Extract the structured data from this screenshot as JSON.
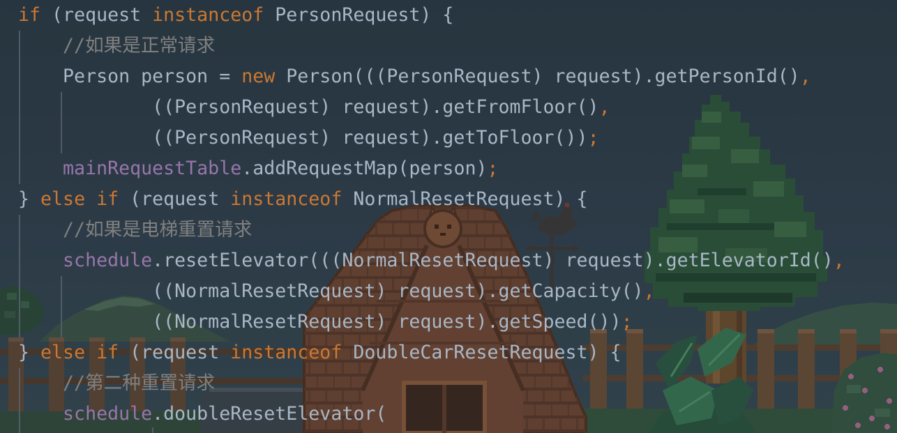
{
  "editor": {
    "colors": {
      "background": "#2b3a45",
      "text": "#A9B7C6",
      "keyword": "#CC7832",
      "field": "#9876AA",
      "comment": "#808080",
      "punctuation": "#CC7832",
      "indent_guide": "#56626d"
    },
    "lines": [
      [
        {
          "kw": "if"
        },
        {
          "txt": " (request "
        },
        {
          "kw": "instanceof"
        },
        {
          "txt": " PersonRequest) {"
        }
      ],
      [
        {
          "txt": "    "
        },
        {
          "cmt": "//如果是正常请求"
        }
      ],
      [
        {
          "txt": "    Person person = "
        },
        {
          "kw": "new"
        },
        {
          "txt": " Person(((PersonRequest) request).getPersonId()"
        },
        {
          "pun": ","
        }
      ],
      [
        {
          "txt": "            ((PersonRequest) request).getFromFloor()"
        },
        {
          "pun": ","
        }
      ],
      [
        {
          "txt": "            ((PersonRequest) request).getToFloor())"
        },
        {
          "pun": ";"
        }
      ],
      [
        {
          "txt": "    "
        },
        {
          "fld": "mainRequestTable"
        },
        {
          "txt": ".addRequestMap(person)"
        },
        {
          "pun": ";"
        }
      ],
      [
        {
          "txt": "} "
        },
        {
          "kw": "else if"
        },
        {
          "txt": " (request "
        },
        {
          "kw": "instanceof"
        },
        {
          "txt": " NormalResetRequest) {"
        }
      ],
      [
        {
          "txt": "    "
        },
        {
          "cmt": "//如果是电梯重置请求"
        }
      ],
      [
        {
          "txt": "    "
        },
        {
          "fld": "schedule"
        },
        {
          "txt": ".resetElevator(((NormalResetRequest) request).getElevatorId()"
        },
        {
          "pun": ","
        }
      ],
      [
        {
          "txt": "            ((NormalResetRequest) request).getCapacity()"
        },
        {
          "pun": ","
        }
      ],
      [
        {
          "txt": "            ((NormalResetRequest) request).getSpeed())"
        },
        {
          "pun": ";"
        }
      ],
      [
        {
          "txt": "} "
        },
        {
          "kw": "else if"
        },
        {
          "txt": " (request "
        },
        {
          "kw": "instanceof"
        },
        {
          "txt": " DoubleCarResetRequest) {"
        }
      ],
      [
        {
          "txt": "    "
        },
        {
          "cmt": "//第二种重置请求"
        }
      ],
      [
        {
          "txt": "    "
        },
        {
          "fld": "schedule"
        },
        {
          "txt": ".doubleResetElevator("
        }
      ]
    ]
  }
}
